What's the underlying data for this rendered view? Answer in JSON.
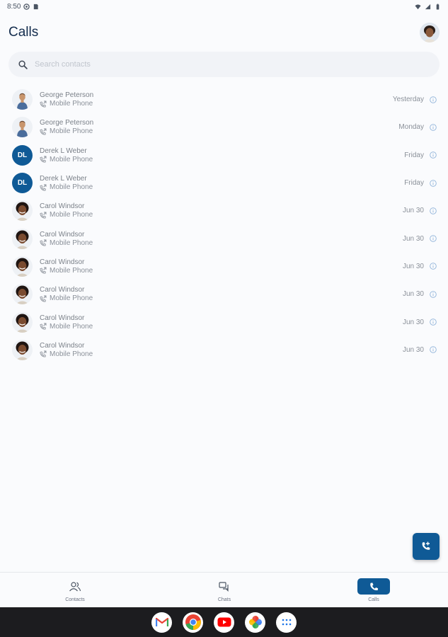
{
  "status_bar": {
    "time": "8:50"
  },
  "header": {
    "title": "Calls"
  },
  "search": {
    "placeholder": "Search contacts",
    "value": ""
  },
  "calls": [
    {
      "name": "George Peterson",
      "type": "Mobile Phone",
      "time": "Yesterday",
      "avatar": "photo-george"
    },
    {
      "name": "George Peterson",
      "type": "Mobile Phone",
      "time": "Monday",
      "avatar": "photo-george"
    },
    {
      "name": "Derek L Weber",
      "type": "Mobile Phone",
      "time": "Friday",
      "avatar": "initials",
      "initials": "DL"
    },
    {
      "name": "Derek L Weber",
      "type": "Mobile Phone",
      "time": "Friday",
      "avatar": "initials",
      "initials": "DL"
    },
    {
      "name": "Carol Windsor",
      "type": "Mobile Phone",
      "time": "Jun 30",
      "avatar": "photo-carol"
    },
    {
      "name": "Carol Windsor",
      "type": "Mobile Phone",
      "time": "Jun 30",
      "avatar": "photo-carol"
    },
    {
      "name": "Carol Windsor",
      "type": "Mobile Phone",
      "time": "Jun 30",
      "avatar": "photo-carol"
    },
    {
      "name": "Carol Windsor",
      "type": "Mobile Phone",
      "time": "Jun 30",
      "avatar": "photo-carol"
    },
    {
      "name": "Carol Windsor",
      "type": "Mobile Phone",
      "time": "Jun 30",
      "avatar": "photo-carol"
    },
    {
      "name": "Carol Windsor",
      "type": "Mobile Phone",
      "time": "Jun 30",
      "avatar": "photo-carol"
    }
  ],
  "bottom_nav": {
    "contacts": "Contacts",
    "chats": "Chats",
    "calls": "Calls",
    "active": "calls"
  },
  "dock": {
    "apps": [
      "gmail-icon",
      "chrome-icon",
      "youtube-icon",
      "photos-icon",
      "app-drawer-icon"
    ]
  },
  "colors": {
    "accent": "#0f5a96",
    "title": "#132c4d",
    "background": "#fafbfd",
    "dock": "#1c1c1f"
  }
}
